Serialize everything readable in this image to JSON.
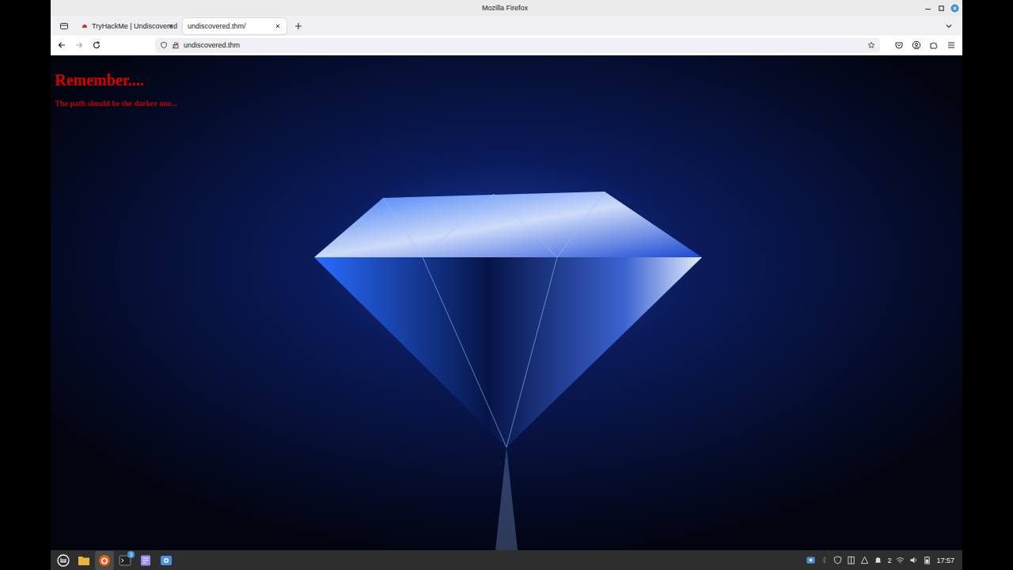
{
  "window": {
    "title": "Mozilla Firefox"
  },
  "tabs": [
    {
      "label": "TryHackMe | Undiscovered",
      "selected": false
    },
    {
      "label": "undiscovered.thm/",
      "selected": true
    }
  ],
  "address_bar": {
    "url": "undiscovered.thm"
  },
  "page": {
    "heading": "Remember....",
    "subtext": "The path should be the darker one..."
  },
  "taskbar": {
    "launchers": [
      {
        "kind": "files",
        "active": false,
        "badge": ""
      },
      {
        "kind": "firefox",
        "active": true,
        "badge": ""
      },
      {
        "kind": "terminal",
        "active": false,
        "badge": "3"
      },
      {
        "kind": "editor",
        "active": false,
        "badge": ""
      },
      {
        "kind": "screenshot",
        "active": false,
        "badge": ""
      }
    ],
    "workspace": "2",
    "clock": "17:57"
  }
}
